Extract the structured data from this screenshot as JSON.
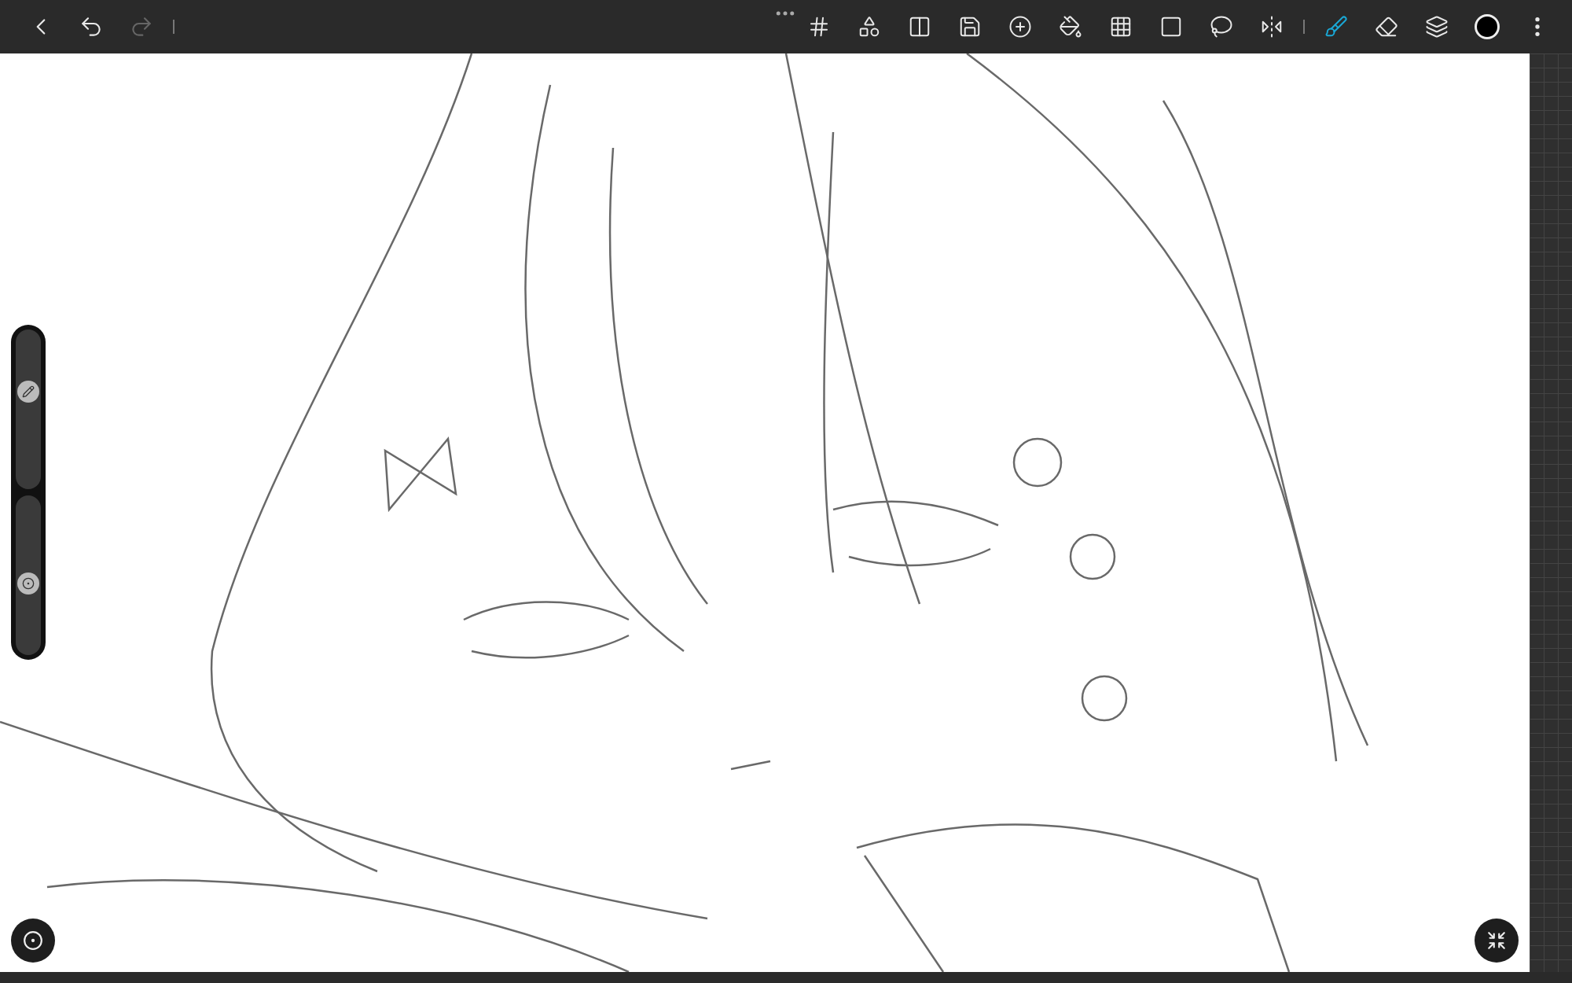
{
  "history": {
    "undo_disabled": false,
    "redo_disabled": true
  },
  "tools": [
    {
      "kind": "grid",
      "selected": false
    },
    {
      "kind": "shapes",
      "selected": false
    },
    {
      "kind": "split",
      "selected": false
    },
    {
      "kind": "save",
      "selected": false
    },
    {
      "kind": "add",
      "selected": false
    },
    {
      "kind": "fill",
      "selected": false
    },
    {
      "kind": "perspective",
      "selected": false
    },
    {
      "kind": "transform",
      "selected": false
    },
    {
      "kind": "lasso",
      "selected": false
    },
    {
      "kind": "symmetry",
      "selected": false
    },
    {
      "kind": "brush",
      "selected": true
    },
    {
      "kind": "eraser",
      "selected": false
    },
    {
      "kind": "layers",
      "selected": false
    },
    {
      "kind": "color",
      "selected": false,
      "color": "#000000"
    }
  ],
  "side_sliders": [
    {
      "kind": "size",
      "level": 0.61
    },
    {
      "kind": "opacity",
      "level": 0.45
    }
  ]
}
